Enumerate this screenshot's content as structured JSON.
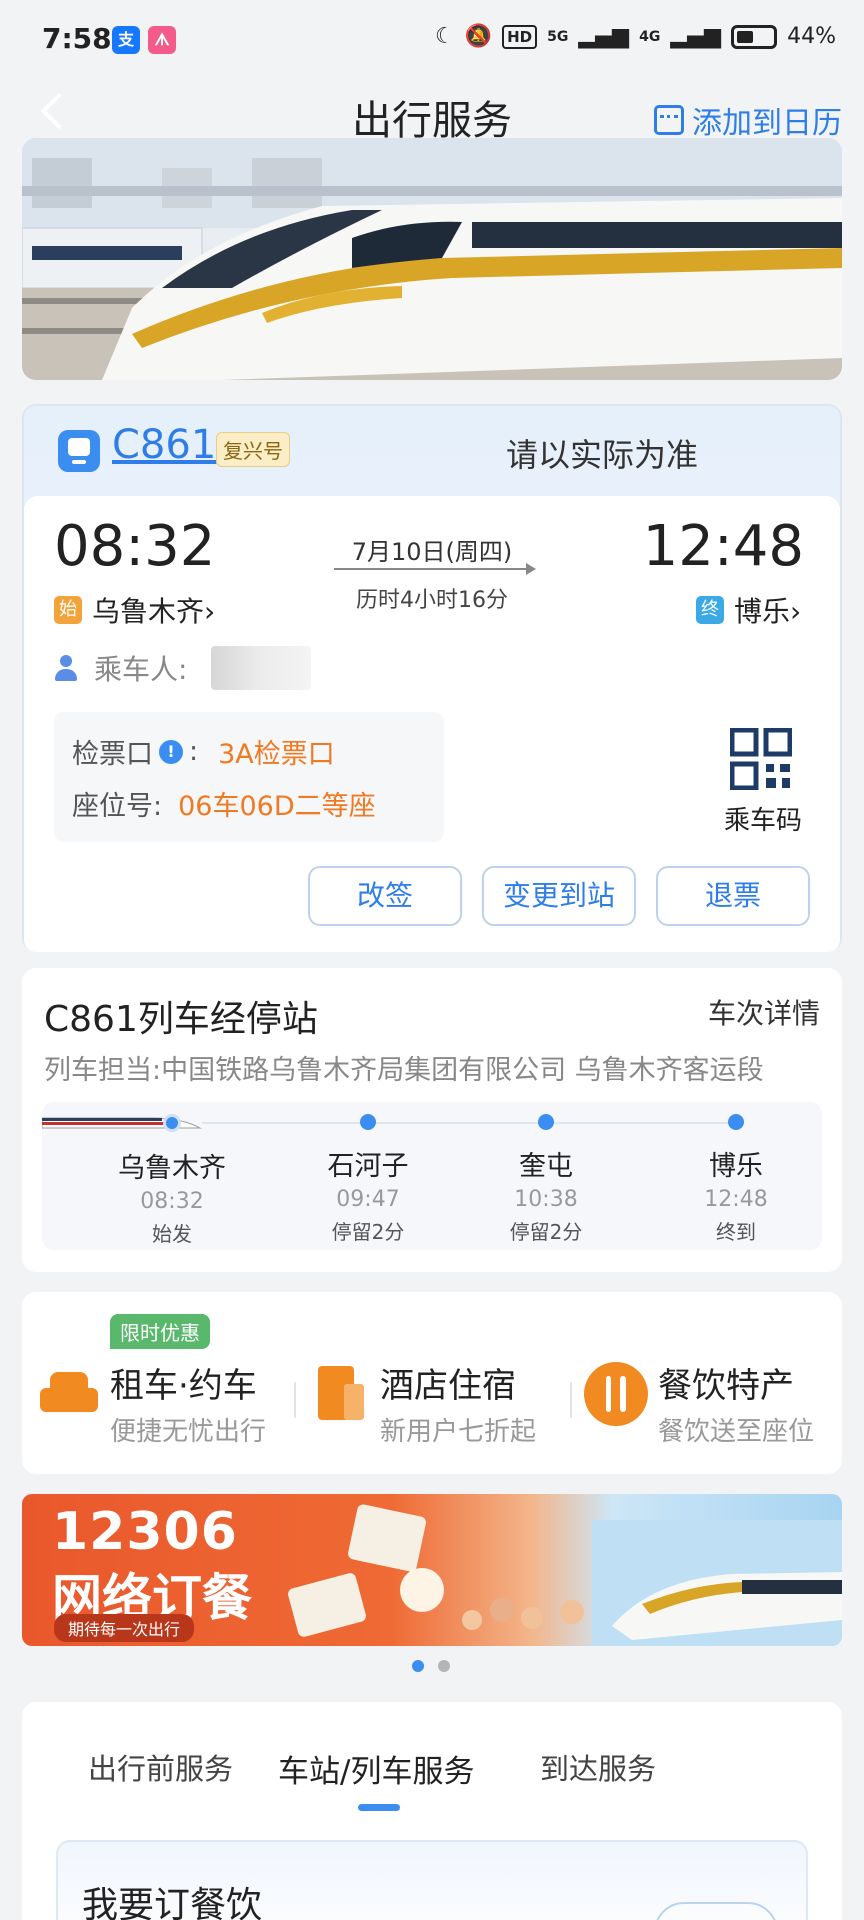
{
  "status_bar": {
    "time": "7:58",
    "app_icons": [
      "支",
      "ᗑ"
    ],
    "hd": "HD",
    "net1": "5G",
    "net2": "4G",
    "battery": "44%"
  },
  "header": {
    "title": "出行服务",
    "add_calendar": "添加到日历"
  },
  "ticket": {
    "train_no": "C861",
    "train_type": "复兴号",
    "notice": "请以实际为准",
    "dep_time": "08:32",
    "arr_time": "12:48",
    "date": "7月10日(周四)",
    "duration": "历时4小时16分",
    "dep_badge": "始",
    "dep_station": "乌鲁木齐›",
    "arr_badge": "终",
    "arr_station": "博乐›",
    "passenger_label": "乘车人:",
    "gate_label": "检票口",
    "gate_value": "3A检票口",
    "seat_label": "座位号:",
    "seat_value": "06车06D二等座",
    "qr_label": "乘车码",
    "actions": [
      "改签",
      "变更到站",
      "退票"
    ]
  },
  "stops": {
    "title": "C861列车经停站",
    "detail_link": "车次详情",
    "operator": "列车担当:中国铁路乌鲁木齐局集团有限公司 乌鲁木齐客运段",
    "list": [
      {
        "name": "乌鲁木齐",
        "time": "08:32",
        "note": "始发"
      },
      {
        "name": "石河子",
        "time": "09:47",
        "note": "停留2分"
      },
      {
        "name": "奎屯",
        "time": "10:38",
        "note": "停留2分"
      },
      {
        "name": "博乐",
        "time": "12:48",
        "note": "终到"
      }
    ]
  },
  "services": {
    "promo": "限时优惠",
    "items": [
      {
        "name": "租车·约车",
        "desc": "便捷无忧出行"
      },
      {
        "name": "酒店住宿",
        "desc": "新用户七折起"
      },
      {
        "name": "餐饮特产",
        "desc": "餐饮送至座位"
      }
    ]
  },
  "ad": {
    "number": "12306",
    "title": "网络订餐",
    "slogan": "期待每一次出行"
  },
  "tabs": {
    "items": [
      "出行前服务",
      "车站/列车服务",
      "到达服务"
    ],
    "active": "车站/列车服务",
    "order_title": "我要订餐饮"
  },
  "colors": {
    "accent": "#2f7ee8",
    "highlight": "#f07a22",
    "service_icon": "#f28a22"
  }
}
